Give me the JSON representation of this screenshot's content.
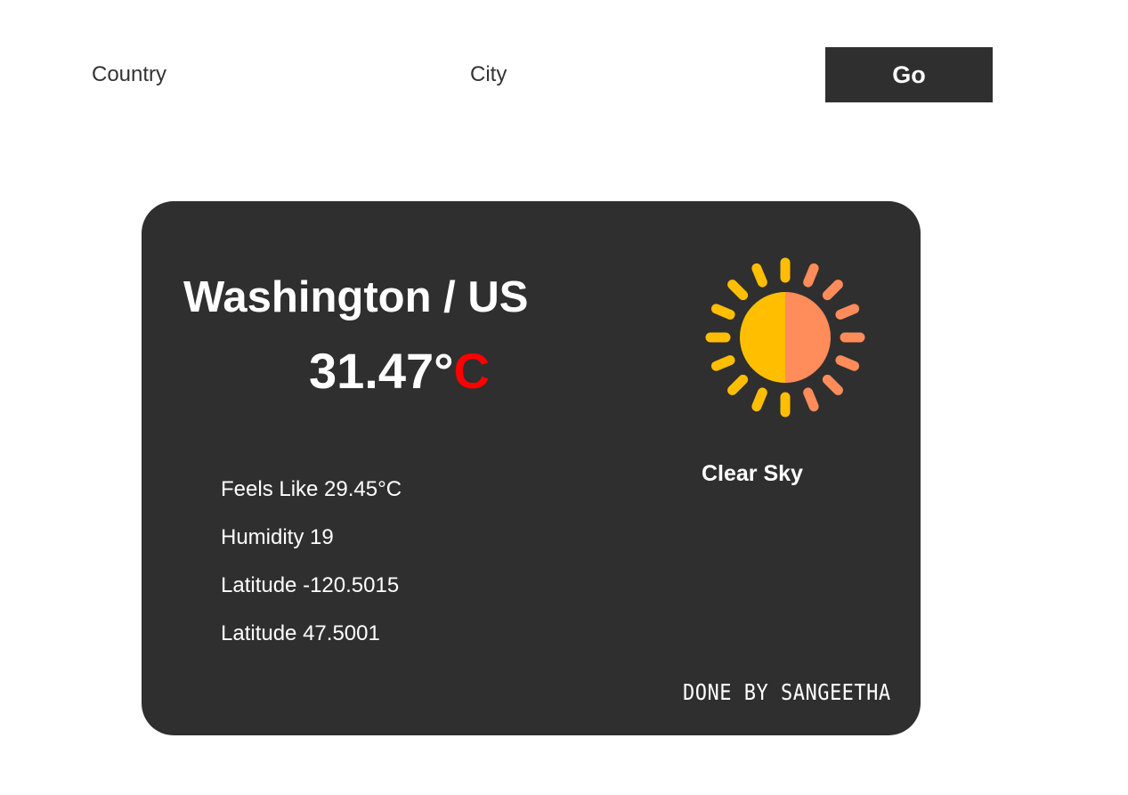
{
  "search": {
    "country_placeholder": "Country",
    "city_placeholder": "City",
    "go_label": "Go"
  },
  "weather": {
    "location": "Washington / US",
    "temperature_value": "31.47°",
    "temperature_unit": "C",
    "icon": "sun-icon",
    "condition": "Clear Sky",
    "details": [
      "Feels Like 29.45°C",
      "Humidity 19",
      "Latitude -120.5015",
      "Latitude 47.5001"
    ],
    "credit": "DONE BY SANGEETHA"
  },
  "colors": {
    "card_background": "#2f2f2f",
    "unit_accent": "#ff0000",
    "sun_yellow": "#ffbf00",
    "sun_orange": "#ff8c5a"
  }
}
